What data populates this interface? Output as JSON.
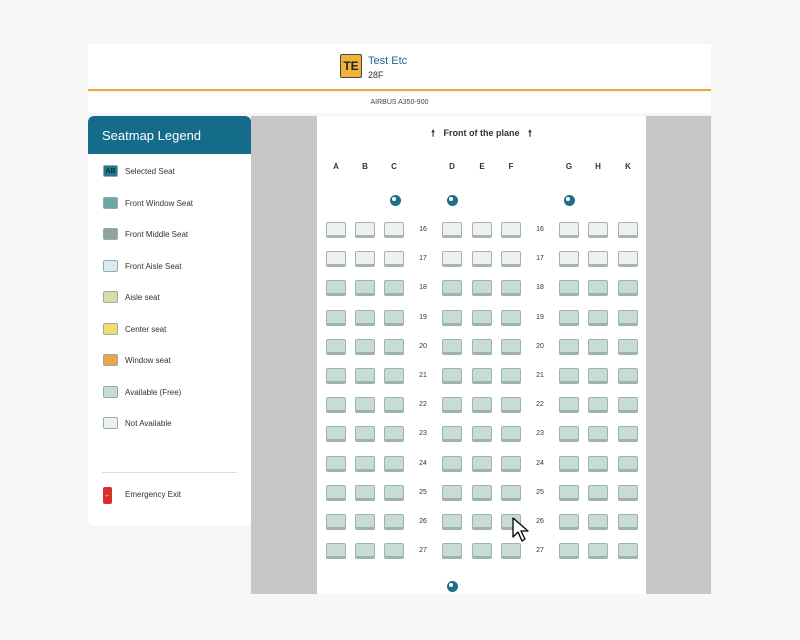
{
  "passenger": {
    "initials": "TE",
    "name": "Test Etc",
    "seat": "28F"
  },
  "aircraft": "AIRBUS A350-900",
  "legend": {
    "title": "Seatmap Legend",
    "items": [
      {
        "label": "Selected Seat",
        "swatch_text": "AB",
        "color": "#1f7a8c"
      },
      {
        "label": "Front Window Seat",
        "swatch_text": "",
        "color": "#6fa7a5"
      },
      {
        "label": "Front Middle Seat",
        "swatch_text": "",
        "color": "#8fa3a3"
      },
      {
        "label": "Front Aisle Seat",
        "swatch_text": "",
        "color": "#d6ecef"
      },
      {
        "label": "Aisle seat",
        "swatch_text": "",
        "color": "#d9dca8"
      },
      {
        "label": "Center seat",
        "swatch_text": "",
        "color": "#f2dc6a"
      },
      {
        "label": "Window seat",
        "swatch_text": "",
        "color": "#f0a44a"
      },
      {
        "label": "Available (Free)",
        "swatch_text": "",
        "color": "#c7dcd5"
      },
      {
        "label": "Not Available",
        "swatch_text": "",
        "color": "#edf0f0"
      }
    ],
    "exit": {
      "label": "Emergency Exit",
      "icon": "exit-arrow-icon"
    }
  },
  "seatmap": {
    "front_label": "Front of the plane",
    "columns": [
      "A",
      "B",
      "C",
      "D",
      "E",
      "F",
      "G",
      "H",
      "K"
    ],
    "rows": [
      {
        "number": "16",
        "status": [
          "na",
          "na",
          "na",
          "na",
          "na",
          "na",
          "na",
          "na",
          "na"
        ]
      },
      {
        "number": "17",
        "status": [
          "na",
          "na",
          "na",
          "na",
          "na",
          "na",
          "na",
          "na",
          "na"
        ]
      },
      {
        "number": "18",
        "status": [
          "av",
          "av",
          "av",
          "av",
          "av",
          "av",
          "av",
          "av",
          "av"
        ]
      },
      {
        "number": "19",
        "status": [
          "av",
          "av",
          "av",
          "av",
          "av",
          "av",
          "av",
          "av",
          "av"
        ]
      },
      {
        "number": "20",
        "status": [
          "av",
          "av",
          "av",
          "av",
          "av",
          "av",
          "av",
          "av",
          "av"
        ]
      },
      {
        "number": "21",
        "status": [
          "av",
          "av",
          "av",
          "av",
          "av",
          "av",
          "av",
          "av",
          "av"
        ]
      },
      {
        "number": "22",
        "status": [
          "av",
          "av",
          "av",
          "av",
          "av",
          "av",
          "av",
          "av",
          "av"
        ]
      },
      {
        "number": "23",
        "status": [
          "av",
          "av",
          "av",
          "av",
          "av",
          "av",
          "av",
          "av",
          "av"
        ]
      },
      {
        "number": "24",
        "status": [
          "av",
          "av",
          "av",
          "av",
          "av",
          "av",
          "av",
          "av",
          "av"
        ]
      },
      {
        "number": "25",
        "status": [
          "av",
          "av",
          "av",
          "av",
          "av",
          "av",
          "av",
          "av",
          "av"
        ]
      },
      {
        "number": "26",
        "status": [
          "av",
          "av",
          "av",
          "av",
          "av",
          "av",
          "av",
          "av",
          "av"
        ]
      },
      {
        "number": "27",
        "status": [
          "av",
          "av",
          "av",
          "av",
          "av",
          "av",
          "av",
          "av",
          "av"
        ]
      }
    ],
    "facility_icon": "lavatory-icon"
  }
}
